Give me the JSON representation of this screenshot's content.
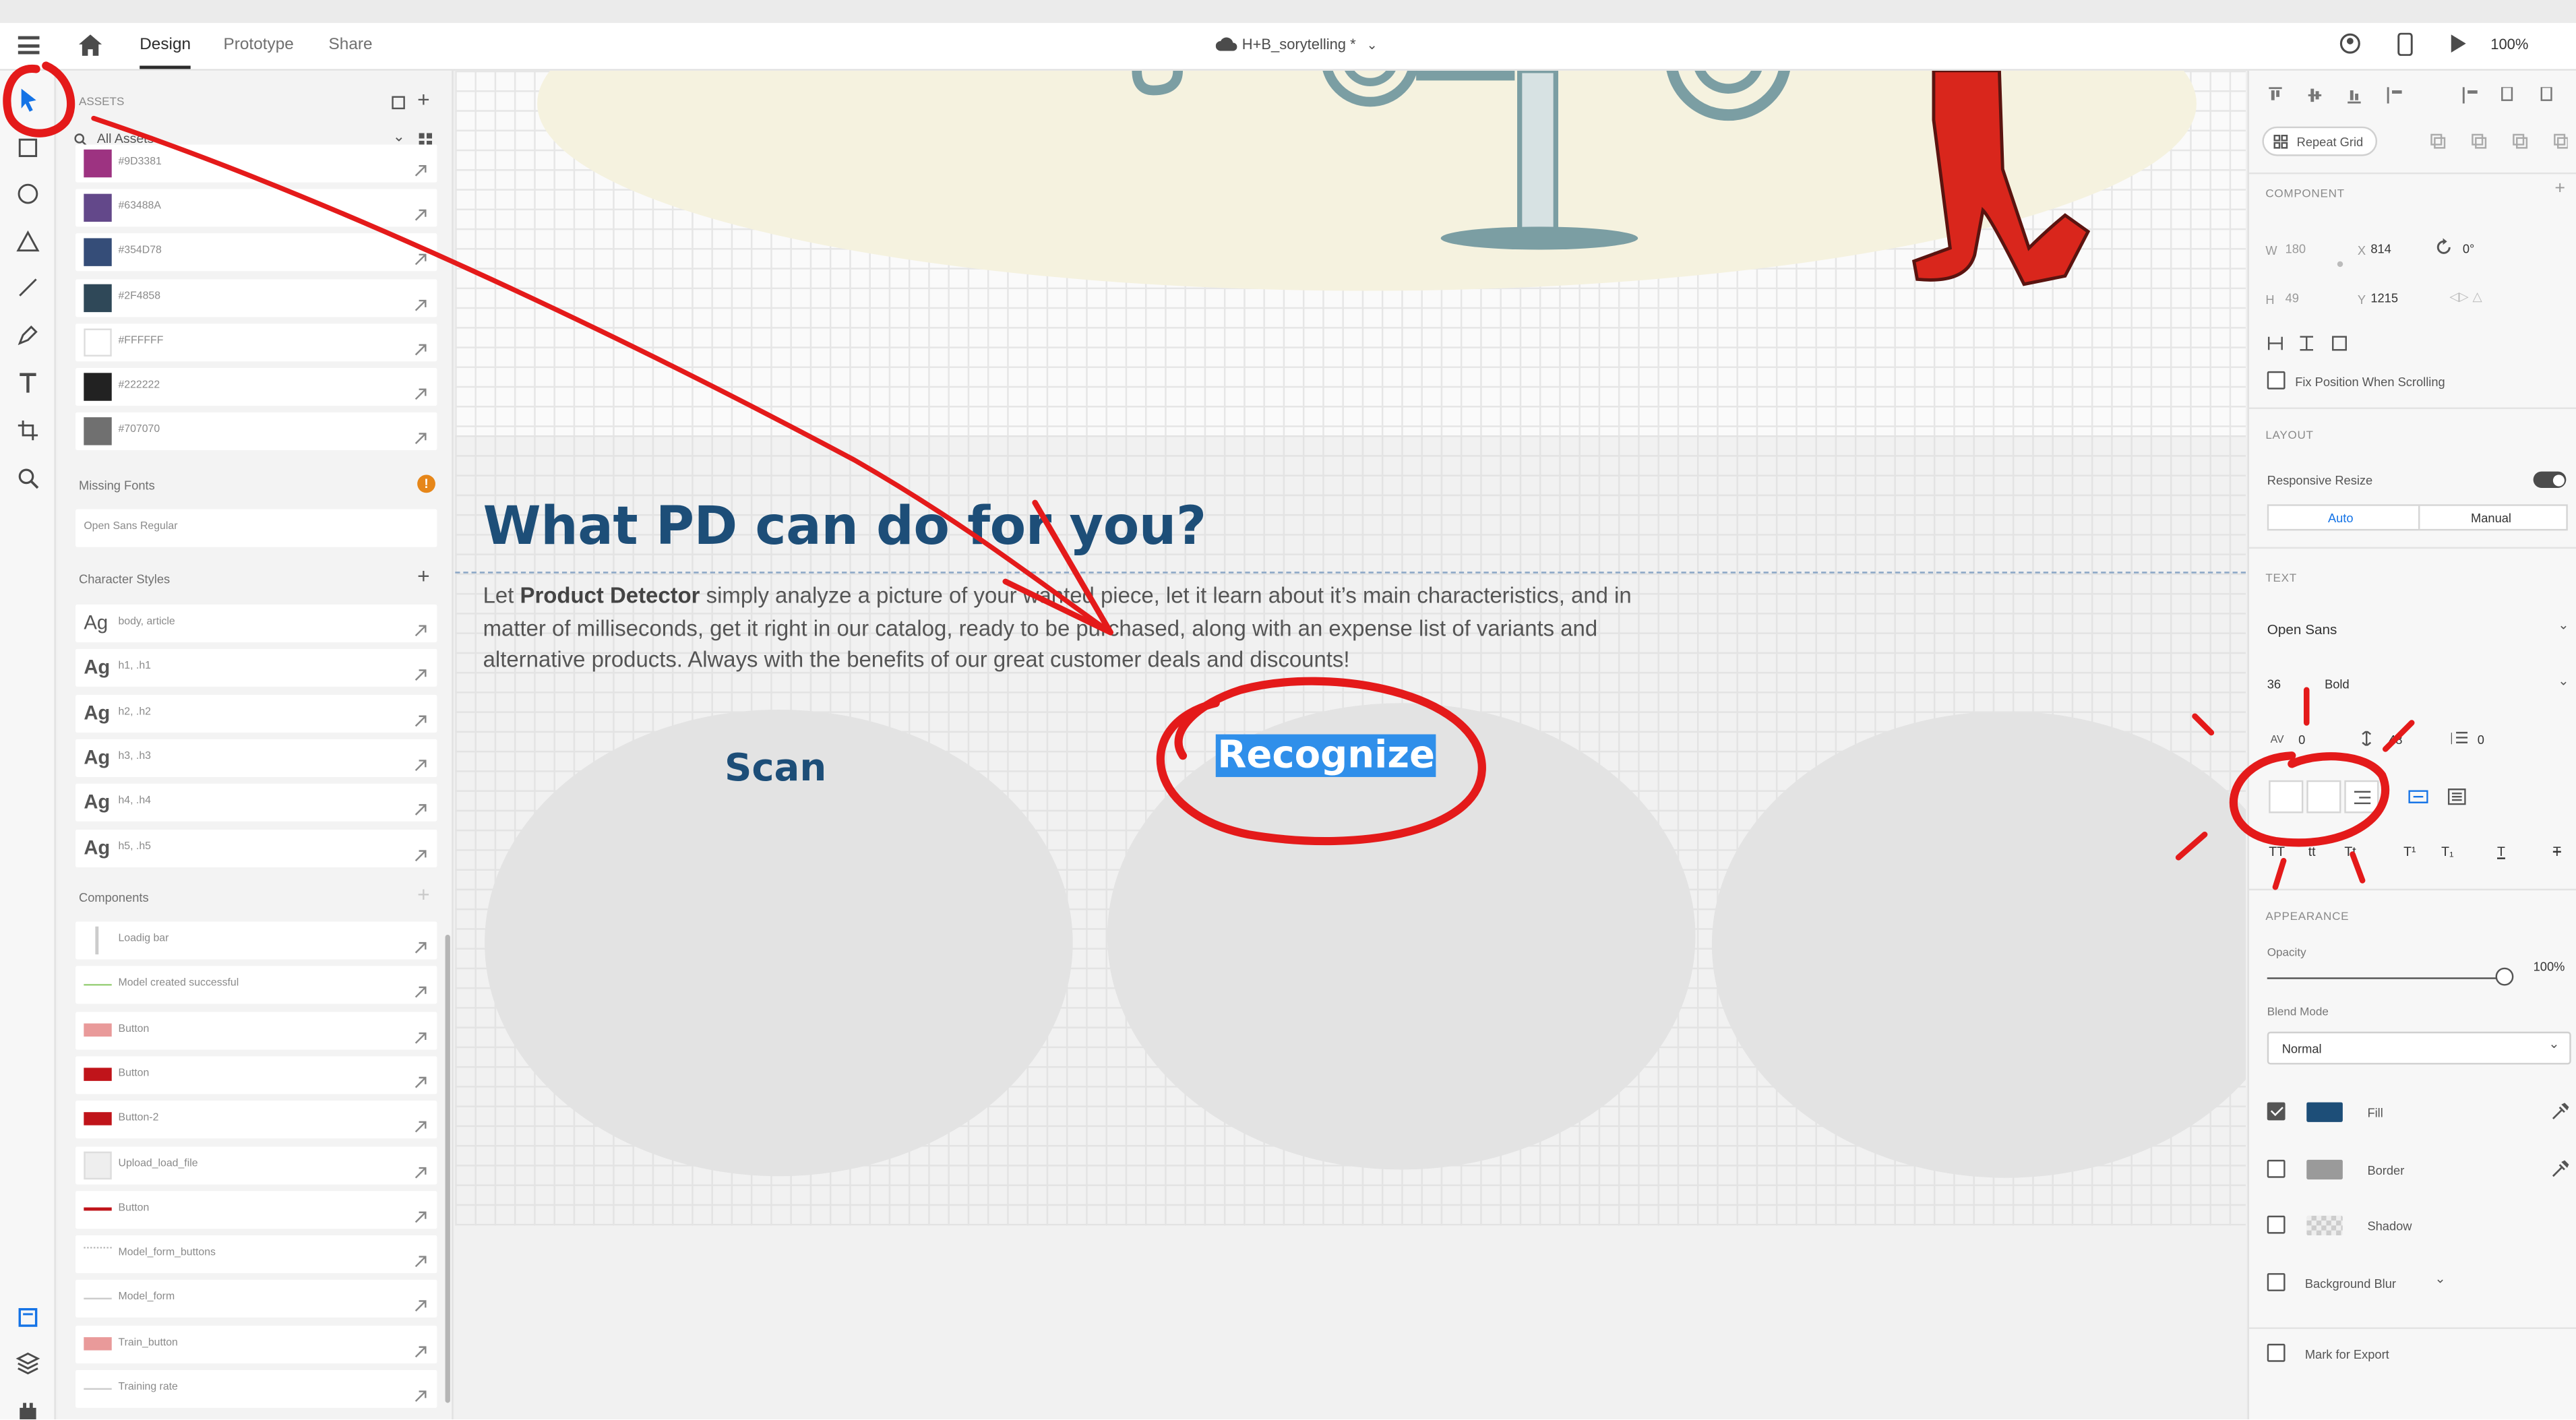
{
  "topbar": {
    "tabs": [
      "Design",
      "Prototype",
      "Share"
    ],
    "document_title": "H+B_sorytelling *",
    "zoom": "100%"
  },
  "toolbar": {
    "tools": [
      "select-tool-icon",
      "rectangle-tool-icon",
      "ellipse-tool-icon",
      "polygon-tool-icon",
      "line-tool-icon",
      "pen-tool-icon",
      "text-tool-icon",
      "artboard-tool-icon",
      "zoom-tool-icon"
    ],
    "bottom": [
      "assets-panel-icon",
      "layers-panel-icon",
      "plugins-icon"
    ]
  },
  "assets": {
    "header": "ASSETS",
    "filter": "All Assets",
    "colors": [
      {
        "label": "#9D3381",
        "hex": "#9D3381"
      },
      {
        "label": "#63488A",
        "hex": "#63488A"
      },
      {
        "label": "#354D78",
        "hex": "#354D78"
      },
      {
        "label": "#2F4858",
        "hex": "#2F4858"
      },
      {
        "label": "#FFFFFF",
        "hex": "#FFFFFF"
      },
      {
        "label": "#222222",
        "hex": "#222222"
      },
      {
        "label": "#707070",
        "hex": "#707070"
      }
    ],
    "missing_fonts_title": "Missing Fonts",
    "missing_font": "Open Sans Regular",
    "char_styles_title": "Character Styles",
    "char_styles": [
      {
        "ag": "Ag",
        "label": "body, article"
      },
      {
        "ag": "Ag",
        "label": "h1, .h1"
      },
      {
        "ag": "Ag",
        "label": "h2, .h2"
      },
      {
        "ag": "Ag",
        "label": "h3, .h3"
      },
      {
        "ag": "Ag",
        "label": "h4, .h4"
      },
      {
        "ag": "Ag",
        "label": "h5, .h5"
      }
    ],
    "components_title": "Components",
    "components": [
      "Loadig bar",
      "Model created successful",
      "Button",
      "Button",
      "Button-2",
      "Upload_load_file",
      "Button",
      "Model_form_buttons",
      "Model_form",
      "Train_button",
      "Training rate"
    ]
  },
  "canvas": {
    "headline": "What PD can do for you?",
    "body_pre": "Let ",
    "body_bold": "Product Detector",
    "body_post": " simply analyze a picture of your wanted piece, let it learn about it’s  main characteristics, and in matter of milliseconds, get it right in our catalog, ready to be purchased, along with an expense list of variants and alternative products. Always with the benefits of our great customer deals and discounts!",
    "card_labels": [
      "Scan",
      "Recognize"
    ]
  },
  "properties": {
    "repeat_grid": "Repeat Grid",
    "component_header": "COMPONENT",
    "w_label": "W",
    "w": "180",
    "x_label": "X",
    "x": "814",
    "h_label": "H",
    "h": "49",
    "y_label": "Y",
    "y": "1215",
    "rotation": "0°",
    "fix_position": "Fix Position When Scrolling",
    "layout_header": "LAYOUT",
    "responsive_resize": "Responsive Resize",
    "auto": "Auto",
    "manual": "Manual",
    "text_header": "TEXT",
    "font": "Open Sans",
    "font_size": "36",
    "font_weight": "Bold",
    "char_spacing_label": "AV",
    "char_spacing": "0",
    "line_spacing": "48",
    "para_spacing": "0",
    "appearance_header": "APPEARANCE",
    "opacity_label": "Opacity",
    "opacity": "100%",
    "blend_mode_label": "Blend Mode",
    "blend_mode": "Normal",
    "fill": "Fill",
    "fill_color": "#1D4E78",
    "border": "Border",
    "shadow": "Shadow",
    "background_blur": "Background Blur",
    "mark_for_export": "Mark for Export"
  }
}
